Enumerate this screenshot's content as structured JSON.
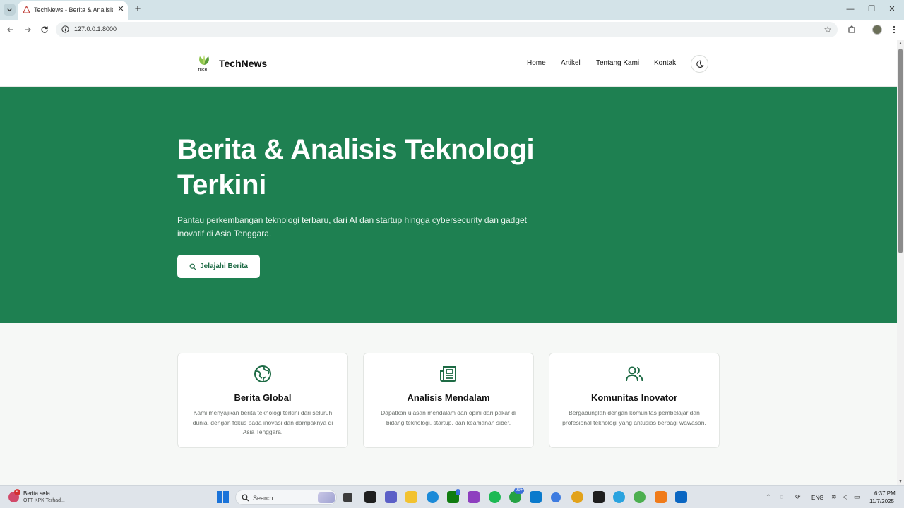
{
  "browser": {
    "tab_title": "TechNews - Berita & Analisis T",
    "url": "127.0.0.1:8000"
  },
  "header": {
    "brand": "TechNews",
    "logo_text": "TECH",
    "nav": [
      "Home",
      "Artikel",
      "Tentang Kami",
      "Kontak"
    ]
  },
  "hero": {
    "title": "Berita & Analisis Teknologi Terkini",
    "subtitle": "Pantau perkembangan teknologi terbaru, dari AI dan startup hingga cybersecurity dan gadget inovatif di Asia Tenggara.",
    "cta_label": "Jelajahi Berita"
  },
  "features": [
    {
      "icon": "globe-icon",
      "title": "Berita Global",
      "description": "Kami menyajikan berita teknologi terkini dari seluruh dunia, dengan fokus pada inovasi dan dampaknya di Asia Tenggara."
    },
    {
      "icon": "newspaper-icon",
      "title": "Analisis Mendalam",
      "description": "Dapatkan ulasan mendalam dan opini dari pakar di bidang teknologi, startup, dan keamanan siber."
    },
    {
      "icon": "users-icon",
      "title": "Komunitas Inovator",
      "description": "Bergabunglah dengan komunitas pembelajar dan profesional teknologi yang antusias berbagi wawasan."
    }
  ],
  "taskbar": {
    "news_title": "Berita sela",
    "news_desc": "OTT KPK Terhad...",
    "news_badge": "4",
    "search_placeholder": "Search",
    "teams_badge": "1",
    "whatsapp_badge": "99+",
    "language": "ENG",
    "time": "6:37 PM",
    "date": "11/7/2025"
  },
  "colors": {
    "brand_green": "#1e8051",
    "icon_green": "#1e6b45"
  }
}
